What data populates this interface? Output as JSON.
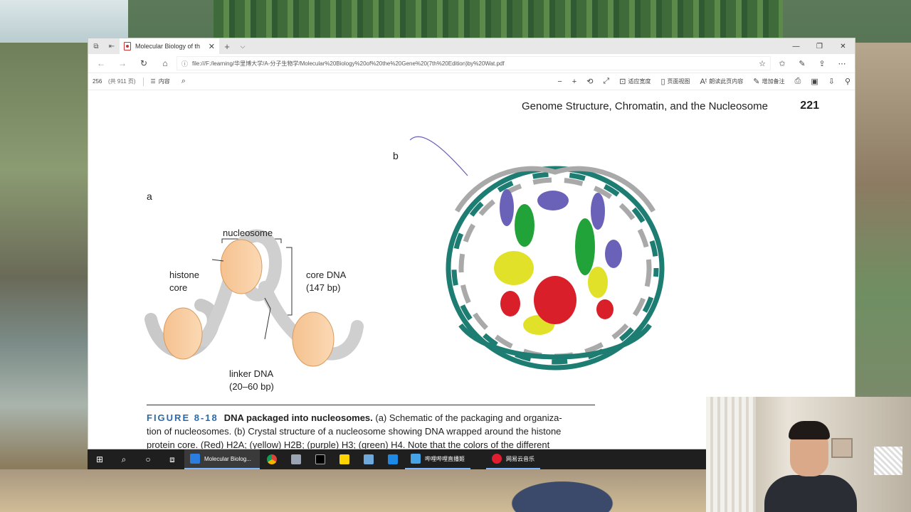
{
  "browser": {
    "tab_title": "Molecular Biology of th",
    "url": "file:///F:/learning/华里博大学/A-分子生物学/Molecular%20Biology%20of%20the%20Gene%20(7th%20Edition)by%20Wat.pdf"
  },
  "pdf_toolbar": {
    "page_number": "256",
    "page_total": "(共 911 页)",
    "toc_label": "内容",
    "fit_label": "适应宽度",
    "page_view_label": "页面视图",
    "read_aloud_label": "朗读此页内容",
    "add_notes_label": "增加备注"
  },
  "page": {
    "running_head": "Genome Structure, Chromatin, and the Nucleosome",
    "page_number": "221"
  },
  "figure": {
    "label_a": "a",
    "label_b": "b",
    "nucleosome": "nucleosome",
    "histone_core_1": "histone",
    "histone_core_2": "core",
    "core_dna_1": "core DNA",
    "core_dna_2": "(147 bp)",
    "linker_dna_1": "linker DNA",
    "linker_dna_2": "(20–60 bp)"
  },
  "caption": {
    "number": "FIGURE 8-18",
    "title": "DNA packaged into nucleosomes.",
    "line1": " (a) Schematic of the packaging and organiza-",
    "line2": "tion of nucleosomes. (b) Crystal structure of a nucleosome showing DNA wrapped around the histone",
    "line3": "protein core. (Red) H2A; (yellow) H2B; (purple) H3; (green) H4. Note that the colors of the different"
  },
  "taskbar": {
    "app_browser": "Molecular Biolog...",
    "app_live": "哔哩哔哩直播姬",
    "app_music": "网易云音乐"
  },
  "colors": {
    "h2a": "#d81f2a",
    "h2b": "#e1e12a",
    "h3": "#6a62b8",
    "h4": "#22a33a",
    "dna_teal": "#1d7d72",
    "dna_gray": "#a9a9a9",
    "caption_blue": "#2a6aa8",
    "histone_core": "#f7c89a"
  }
}
